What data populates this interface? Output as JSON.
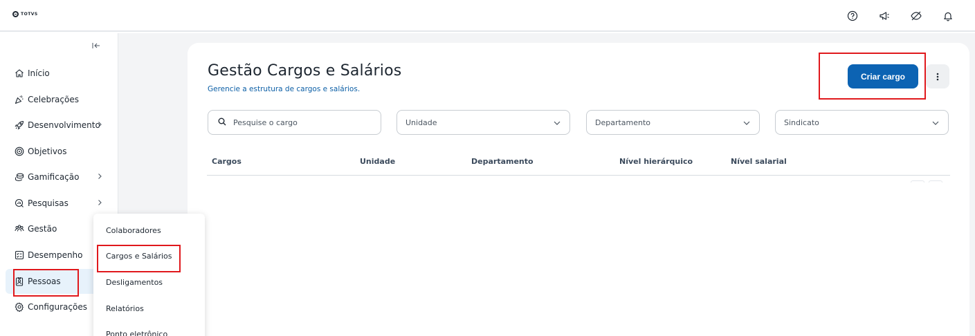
{
  "brand": {
    "logo_text": "TOTVS"
  },
  "topbar": {
    "icons": [
      "help-icon",
      "megaphone-icon",
      "eye-off-icon",
      "bell-icon"
    ]
  },
  "sidebar": {
    "collapse_icon": "collapse-left-icon",
    "items": [
      {
        "label": "Início",
        "icon": "home-icon",
        "has_submenu": false
      },
      {
        "label": "Celebrações",
        "icon": "party-icon",
        "has_submenu": false
      },
      {
        "label": "Desenvolvimento",
        "icon": "rocket-icon",
        "has_submenu": true
      },
      {
        "label": "Objetivos",
        "icon": "target-icon",
        "has_submenu": false
      },
      {
        "label": "Gamificação",
        "icon": "coins-icon",
        "has_submenu": true
      },
      {
        "label": "Pesquisas",
        "icon": "survey-icon",
        "has_submenu": true
      },
      {
        "label": "Gestão",
        "icon": "team-icon",
        "has_submenu": false
      },
      {
        "label": "Desempenho",
        "icon": "checklist-icon",
        "has_submenu": false
      },
      {
        "label": "Pessoas",
        "icon": "badge-icon",
        "has_submenu": false,
        "active": true
      },
      {
        "label": "Configurações",
        "icon": "gear-icon",
        "has_submenu": false
      }
    ]
  },
  "submenu": {
    "items": [
      {
        "label": "Colaboradores"
      },
      {
        "label": "Cargos e Salários"
      },
      {
        "label": "Desligamentos"
      },
      {
        "label": "Relatórios"
      },
      {
        "label": "Ponto eletrônico"
      }
    ]
  },
  "page": {
    "title": "Gestão Cargos e Salários",
    "subtitle": "Gerencie a estrutura de cargos e salários.",
    "create_button": "Criar cargo",
    "more_icon": "more-vertical-icon"
  },
  "filters": {
    "search_placeholder": "Pesquise o cargo",
    "unidade": "Unidade",
    "departamento": "Departamento",
    "sindicato": "Sindicato"
  },
  "table": {
    "columns": [
      "Cargos",
      "Unidade",
      "Departamento",
      "Nível hierárquico",
      "Nível salarial"
    ]
  },
  "colors": {
    "primary": "#0c63b3",
    "highlight": "#e0181c",
    "active_bg": "#e7f2fb"
  }
}
